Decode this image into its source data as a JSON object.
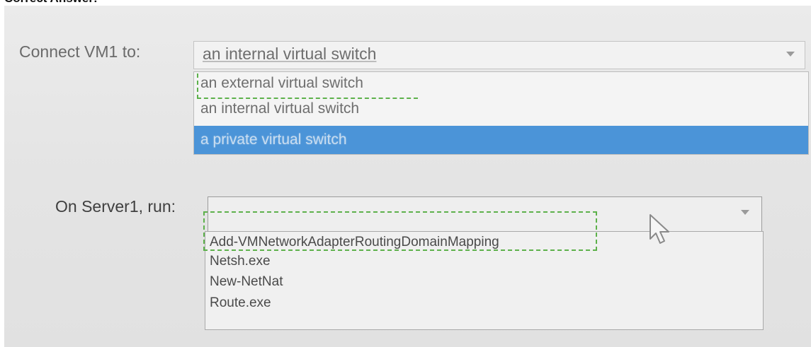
{
  "header": {
    "title": "Correct Answer:"
  },
  "q1": {
    "label": "Connect VM1 to:",
    "selected": "an internal virtual switch",
    "options": [
      "an external virtual switch",
      "an internal virtual switch",
      "a private virtual switch"
    ],
    "highlighted_option": "a private virtual switch",
    "correct_answer": "an external virtual switch"
  },
  "q2": {
    "label": "On Server1, run:",
    "selected": "",
    "options": [
      "Add-VMNetworkAdapterRoutingDomainMapping",
      "Netsh.exe",
      "New-NetNat",
      "Route.exe"
    ],
    "correct_answer": "Add-VMNetworkAdapterRoutingDomainMapping"
  },
  "colors": {
    "highlight": "#4b94d8",
    "answer_marker": "#5db14b"
  },
  "icons": {
    "dropdown": "chevron-down-icon",
    "pointer": "mouse-cursor-icon"
  }
}
